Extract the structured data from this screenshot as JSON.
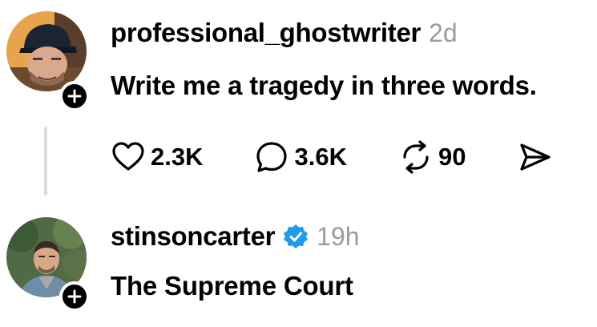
{
  "posts": [
    {
      "username": "professional_ghostwriter",
      "time": "2d",
      "text": "Write me a tragedy in three words.",
      "verified": false,
      "likes": "2.3K",
      "replies": "3.6K",
      "reposts": "90"
    },
    {
      "username": "stinsoncarter",
      "time": "19h",
      "text": "The Supreme Court",
      "verified": true
    }
  ],
  "colors": {
    "verified": "#1d9bf0",
    "muted_text": "#9b9b9b",
    "thread_line": "#dcdcdc"
  },
  "icons": [
    "plus-icon",
    "heart-icon",
    "comment-icon",
    "repost-icon",
    "share-icon",
    "verified-badge-icon"
  ]
}
